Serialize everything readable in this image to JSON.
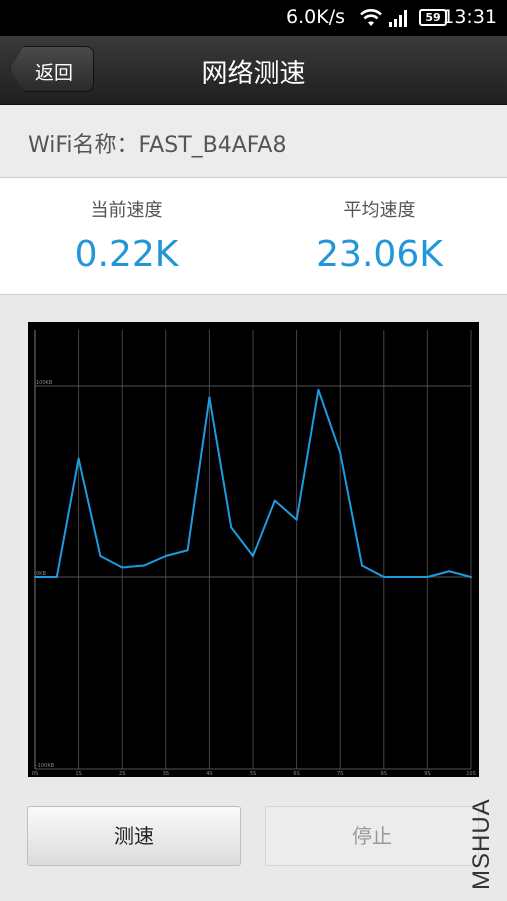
{
  "status_bar": {
    "net_speed": "6.0K/s",
    "battery": "59",
    "time": "13:31"
  },
  "header": {
    "back_label": "返回",
    "title": "网络测速"
  },
  "wifi": {
    "label": "WiFi名称：FAST_B4AFA8"
  },
  "speeds": {
    "current_label": "当前速度",
    "current_value": "0.22K",
    "average_label": "平均速度",
    "average_value": "23.06K"
  },
  "colors": {
    "accent": "#2196d8",
    "line": "#1e9be0"
  },
  "chart_data": {
    "type": "line",
    "x": [
      0,
      5,
      10,
      15,
      20,
      25,
      30,
      35,
      40,
      45,
      50,
      55,
      60,
      65,
      70,
      75,
      80,
      85,
      90,
      95,
      100
    ],
    "x_ticks": [
      "0S",
      "1S",
      "2S",
      "3S",
      "4S",
      "5S",
      "6S",
      "7S",
      "8S",
      "9S",
      "10S"
    ],
    "y_ticks": [
      "100KB",
      "0KB",
      "-100KB"
    ],
    "series": [
      {
        "values": [
          0,
          0,
          62,
          11,
          5,
          6,
          11,
          14,
          94,
          26,
          11,
          40,
          30,
          98,
          65,
          6,
          0,
          0,
          0,
          3,
          0
        ]
      }
    ],
    "ylim": [
      -100,
      100
    ],
    "xlim": [
      0,
      100
    ],
    "grid": true
  },
  "buttons": {
    "test_label": "测速",
    "stop_label": "停止"
  },
  "watermark": "MSHUA"
}
